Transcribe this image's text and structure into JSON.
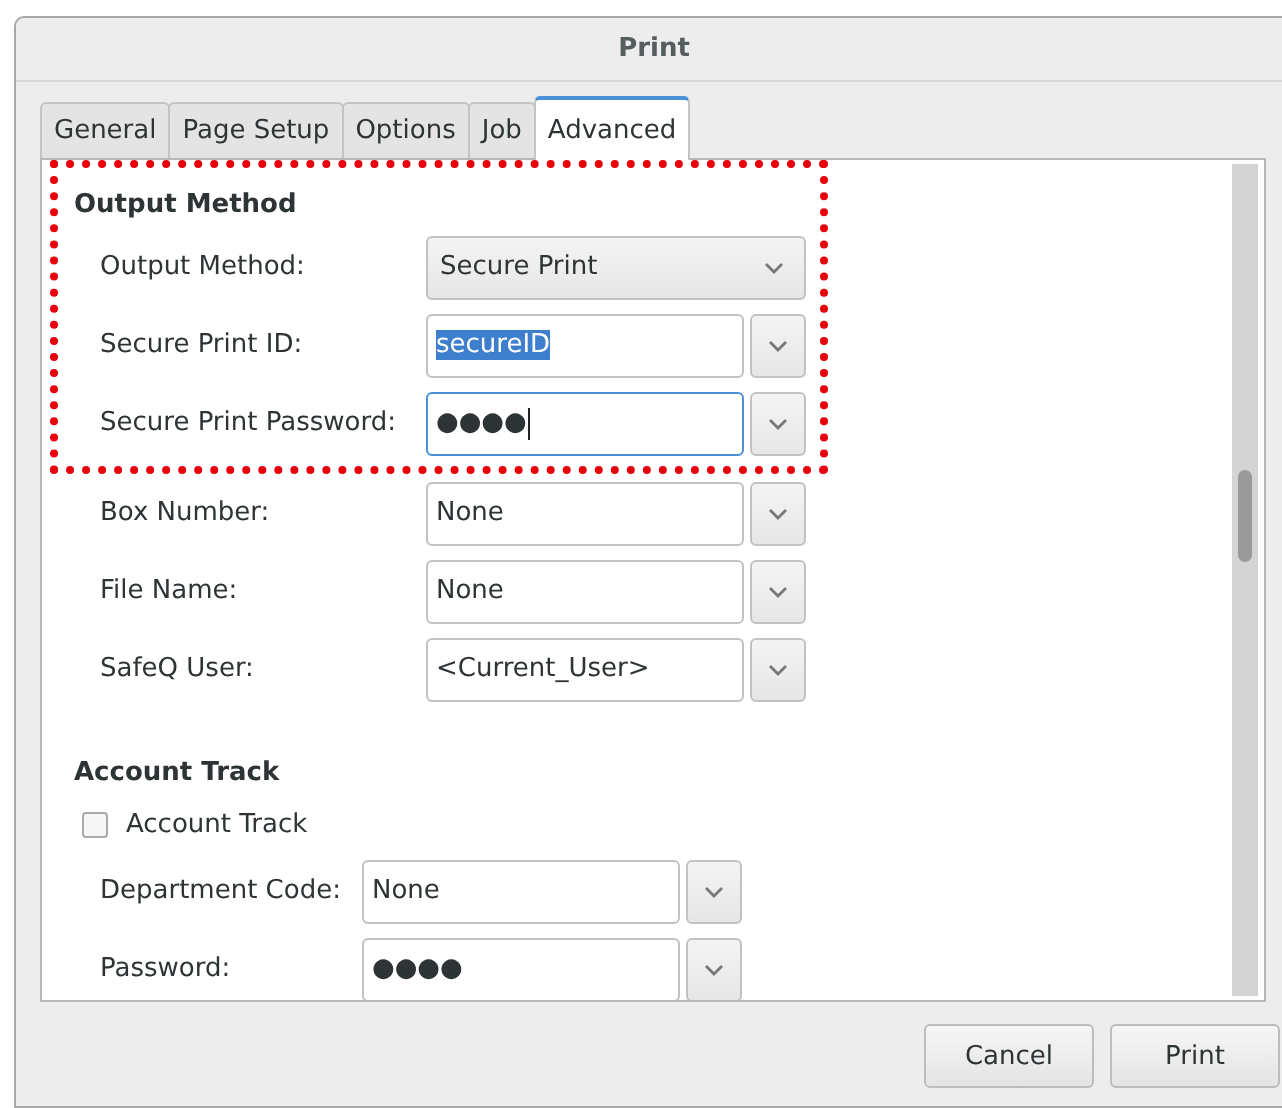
{
  "window": {
    "title": "Print"
  },
  "tabs": [
    {
      "label": "General",
      "selected": false
    },
    {
      "label": "Page Setup",
      "selected": false
    },
    {
      "label": "Options",
      "selected": false
    },
    {
      "label": "Job",
      "selected": false
    },
    {
      "label": "Advanced",
      "selected": true
    }
  ],
  "sections": [
    {
      "heading": "Output Method",
      "rows": [
        {
          "kind": "dropdown",
          "label": "Output Method:",
          "value": "Secure Print",
          "highlighted": true
        },
        {
          "kind": "combo",
          "label": "Secure Print ID:",
          "value": "secureID",
          "text_selected": true,
          "focused": false,
          "highlighted": true
        },
        {
          "kind": "combo",
          "label": "Secure Print Password:",
          "value": "●●●●",
          "text_selected": false,
          "focused": true,
          "highlighted": true
        },
        {
          "kind": "combo",
          "label": "Box Number:",
          "value": "None",
          "text_selected": false,
          "focused": false,
          "highlighted": false
        },
        {
          "kind": "combo",
          "label": "File Name:",
          "value": "None",
          "text_selected": false,
          "focused": false,
          "highlighted": false
        },
        {
          "kind": "combo",
          "label": "SafeQ User:",
          "value": "<Current_User>",
          "text_selected": false,
          "focused": false,
          "highlighted": false
        }
      ]
    },
    {
      "heading": "Account Track",
      "rows": [
        {
          "kind": "checkbox",
          "label": "Account Track",
          "checked": false,
          "highlighted": false
        },
        {
          "kind": "combo",
          "label": "Department Code:",
          "value": "None",
          "text_selected": false,
          "focused": false,
          "highlighted": false
        },
        {
          "kind": "combo",
          "label": "Password:",
          "value": "●●●●",
          "text_selected": false,
          "focused": false,
          "highlighted": false
        }
      ]
    }
  ],
  "buttons": [
    "Cancel",
    "Print"
  ]
}
